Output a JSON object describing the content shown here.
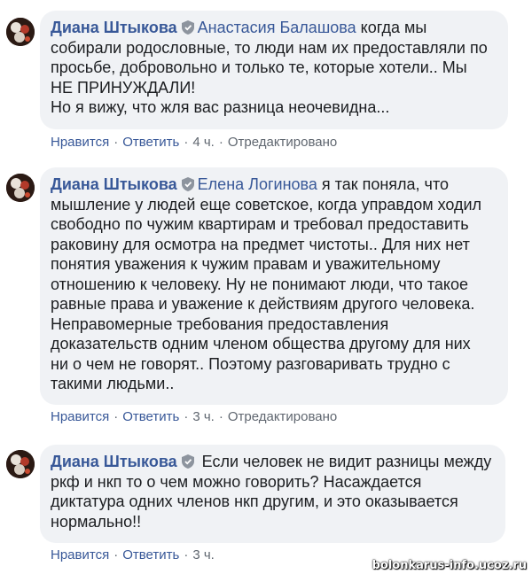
{
  "comments": [
    {
      "author": "Диана Штыкова",
      "verified_icon": "shield-badge-icon",
      "mention": "Анастасия Балашова",
      "lines": [
        " когда мы",
        "собирали родословные, то люди нам их предоставляли по",
        "просьбе, добровольно и только те, которые хотели.. Мы",
        "НЕ ПРИНУЖДАЛИ!",
        "Но я вижу, что жля вас разница неочевидна..."
      ],
      "like_label": "Нравится",
      "reply_label": "Ответить",
      "time": "4 ч.",
      "edited_label": "Отредактировано"
    },
    {
      "author": "Диана Штыкова",
      "verified_icon": "shield-badge-icon",
      "mention": "Елена Логинова",
      "lines": [
        " я так поняла, что",
        "мышление у людей еще советское, когда управдом ходил",
        "свободно по чужим квартирам и требовал предоставить",
        "раковину для осмотра на предмет чистоты.. Для них нет",
        "понятия уважения к чужим правам и уважительному",
        "отношению к человеку. Ну не понимают люди, что такое",
        "равные права и уважение к действиям другого человека.",
        "Неправомерные требования предоставления",
        "доказательств одним членом общества другому для них",
        "ни о чем не говорят.. Поэтому разговаривать трудно с",
        "такими людьми.."
      ],
      "like_label": "Нравится",
      "reply_label": "Ответить",
      "time": "3 ч.",
      "edited_label": "Отредактировано"
    },
    {
      "author": "Диана Штыкова",
      "verified_icon": "shield-badge-icon",
      "mention": "",
      "lines": [
        " Если человек не видит разницы между",
        "ркф и нкп то о чем можно говорить? Насаждается",
        "диктатура одних членов нкп другим, и это оказывается",
        "нормально!!"
      ],
      "like_label": "Нравится",
      "reply_label": "Ответить",
      "time": "3 ч."
    }
  ],
  "separator": "·",
  "watermark": "bolonkarus-info.ucoz.ru",
  "colors": {
    "bubble": "#f0f2f5",
    "link": "#385898",
    "text": "#1c1e21",
    "meta": "#606770"
  }
}
